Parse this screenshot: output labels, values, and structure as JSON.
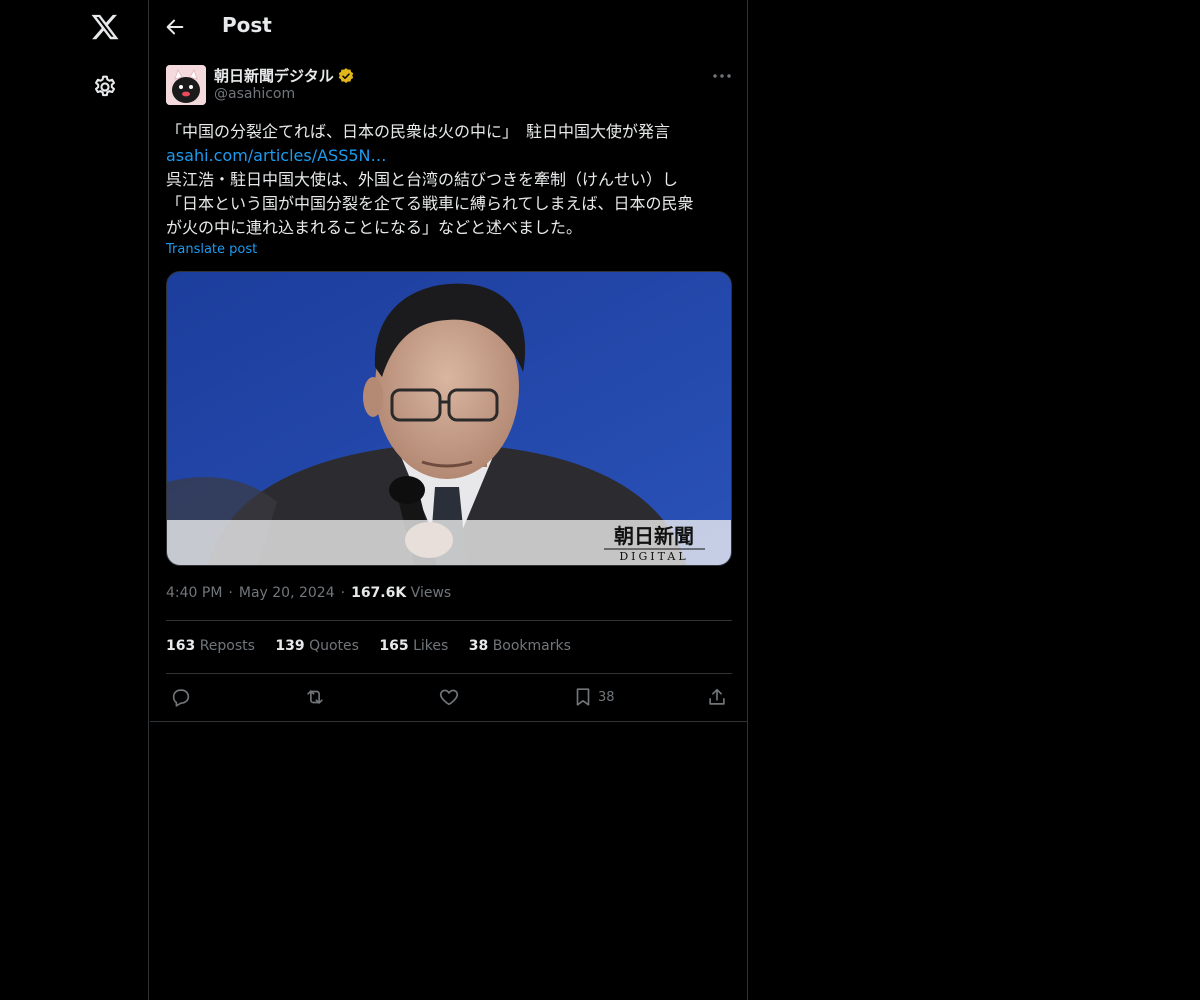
{
  "header": {
    "title": "Post"
  },
  "author": {
    "name": "朝日新聞デジタル",
    "handle": "@asahicom"
  },
  "post": {
    "text_lines": [
      "「中国の分裂企てれば、日本の民衆は火の中に」　駐日中国大使が発言",
      "呉江浩・駐日中国大使は、外国と台湾の結びつきを牽制（けんせい）し",
      "「日本という国が中国分裂を企てる戦車に縛られてしまえば、日本の民衆",
      "が火の中に連れ込まれることになる」などと述べました。"
    ],
    "link_text": "asahi.com/articles/ASS5N…",
    "translate_label": "Translate post",
    "media_watermark": {
      "line1": "朝日新聞",
      "line2": "DIGITAL"
    }
  },
  "meta": {
    "time": "4:40 PM",
    "date": "May 20, 2024",
    "views_count": "167.6K",
    "views_label": "Views"
  },
  "stats": {
    "reposts": "163",
    "reposts_label": "Reposts",
    "quotes": "139",
    "quotes_label": "Quotes",
    "likes": "165",
    "likes_label": "Likes",
    "bookmarks": "38",
    "bookmarks_label": "Bookmarks"
  },
  "actions": {
    "bookmark_count": "38"
  },
  "icons": {
    "rail": [
      "x-logo-icon",
      "gear-icon"
    ],
    "actions": [
      "reply-icon",
      "repost-icon",
      "like-icon",
      "bookmark-icon",
      "share-icon"
    ]
  },
  "colors": {
    "background": "#000000",
    "text": "#e7e9ea",
    "muted": "#71767b",
    "link": "#1d9bf0",
    "border": "#2f3336",
    "verified": "#e2b719"
  }
}
